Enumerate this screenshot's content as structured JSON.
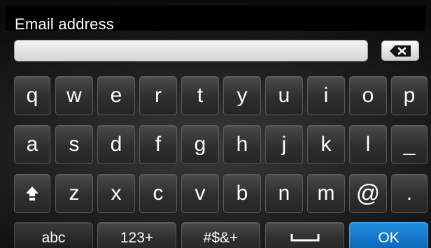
{
  "header": {
    "title": "Email address"
  },
  "input": {
    "value": ""
  },
  "rows": [
    [
      "q",
      "w",
      "e",
      "r",
      "t",
      "y",
      "u",
      "i",
      "o",
      "p"
    ],
    [
      "a",
      "s",
      "d",
      "f",
      "g",
      "h",
      "j",
      "k",
      "l",
      "_"
    ],
    [
      "z",
      "x",
      "c",
      "v",
      "b",
      "n",
      "m",
      "@",
      "."
    ]
  ],
  "bottom": {
    "abc": "abc",
    "num": "123+",
    "sym": "#$&+",
    "ok": "OK"
  },
  "colors": {
    "ok": "#0a63b3",
    "key": "#2e2e2e"
  }
}
